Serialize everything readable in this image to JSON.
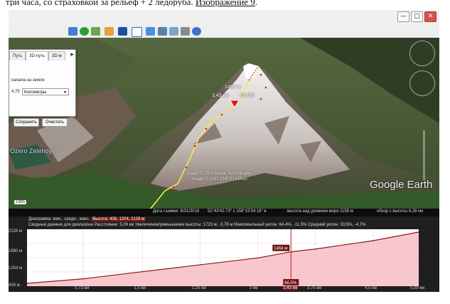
{
  "document": {
    "line_prefix": "три часа, со страховкой за рельеф + 2 ледоруба.",
    "link_text": "Изображение 9"
  },
  "window": {
    "controls": [
      "—",
      "▢",
      "✕"
    ]
  },
  "measure_panel": {
    "tabs": [
      "Путь",
      "3D-путь",
      "3D-м"
    ],
    "ground_label": "начала на земле",
    "length_value": "4,75",
    "unit": "Километры",
    "save_label": "Сохранить",
    "clear_label": "Очистить"
  },
  "map": {
    "place_label": "Ozero Zelenoye",
    "marker_elevation": "1464 м",
    "marker_distance": "3,43 км",
    "marker_slope": "66,5%",
    "credits": [
      "Image © 2021 Maxar Technologies",
      "Image © 2021 CNES / Airbus"
    ],
    "year": "1985",
    "brand": "Google Earth"
  },
  "statusbar": {
    "date": "Дата съемки: 8/31/2018",
    "coords": "52°43'42.73\" с  158°15'34.16\" в",
    "elevation": "высота над уровнем моря  1158 м",
    "eye": "обзор с высоты  6,28 км"
  },
  "profile": {
    "header_label": "Диаграмма: мин., средн., макс.",
    "header_values": "Высота: 408, 1204, 2126 м",
    "summary": "Сводные данные для диапазона   Расстояние: 5,09 км    Увеличение/уменьшение высоты: 1723 м, -3,78 м   Максимальный уклон: 64,4%, -11,5%  Средний уклон: 33,5%, -4,7%",
    "y_ticks": [
      "2126 м",
      "1690 м",
      "1254 м",
      "408 м"
    ],
    "x_ticks": [
      "0,73 км",
      "1,5 км",
      "2,25 км",
      "3 км",
      "3,43 км",
      "3,75 км",
      "4,5 км",
      "5,09 км"
    ],
    "cursor_elevation": "1464 м",
    "cursor_slope": "66,5%"
  },
  "chart_data": {
    "type": "area",
    "x": [
      0,
      0.73,
      1.5,
      2.25,
      3,
      3.43,
      3.75,
      4.5,
      5.09
    ],
    "values": [
      408,
      560,
      800,
      1030,
      1260,
      1464,
      1560,
      1840,
      2126
    ],
    "ylim": [
      408,
      2126
    ],
    "xlim": [
      0,
      5.09
    ],
    "y_ticks": [
      "2126 м",
      "1690 м",
      "1254 м",
      "408 м"
    ],
    "x_ticks": [
      "0,73 км",
      "1,5 км",
      "2,25 км",
      "3 км",
      "3,43 км",
      "3,75 км",
      "4,5 км",
      "5,09 км"
    ],
    "grid": true,
    "colors": {
      "line": "#8b1a1a",
      "fill": "#f6b4bd",
      "marker": "#d01818"
    }
  }
}
